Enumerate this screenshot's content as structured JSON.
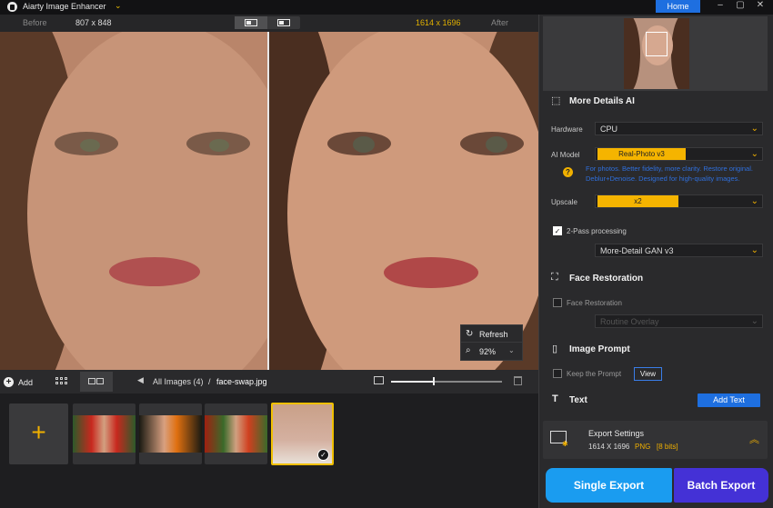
{
  "app": {
    "title": "Aiarty Image Enhancer",
    "home_label": "Home"
  },
  "compare": {
    "before_label": "Before",
    "before_size": "807 x 848",
    "after_size": "1614 x 1696",
    "after_label": "After",
    "view_modes": [
      "split-view-icon",
      "side-by-side-icon"
    ]
  },
  "viewer_tools": {
    "refresh_label": "Refresh",
    "zoom_value": "92%"
  },
  "toolbar": {
    "add_label": "Add",
    "breadcrumb_all": "All Images (4)",
    "breadcrumb_sep": "/",
    "breadcrumb_file": "face-swap.jpg",
    "thumb_size_fraction": 0.39
  },
  "filmstrip": {
    "add_symbol": "+",
    "selected_index": 3,
    "count": 4
  },
  "panel": {
    "more_details": {
      "title": "More Details AI",
      "hardware_label": "Hardware",
      "hardware_value": "CPU",
      "model_label": "AI Model",
      "model_value": "Real-Photo  v3",
      "model_desc": "For photos. Better fidelity, more clarity. Restore original. Deblur+Denoise. Designed for high-quality images.",
      "upscale_label": "Upscale",
      "upscale_value": "x2",
      "two_pass_label": "2-Pass processing",
      "two_pass_checked": true,
      "two_pass_model": "More-Detail GAN  v3"
    },
    "face": {
      "title": "Face Restoration",
      "checkbox_label": "Face Restoration",
      "checked": false,
      "mode_value": "Routine Overlay"
    },
    "prompt": {
      "title": "Image Prompt",
      "keep_label": "Keep the Prompt",
      "keep_checked": false,
      "view_label": "View"
    },
    "text": {
      "title": "Text",
      "add_label": "Add Text"
    },
    "export": {
      "title": "Export Settings",
      "size": "1614 X 1696",
      "format": "PNG",
      "bits": "[8 bits]"
    },
    "single_export_label": "Single Export",
    "batch_export_label": "Batch Export"
  },
  "colors": {
    "accent": "#f5b400",
    "primary": "#1e6fe0",
    "single": "#1a9cf0",
    "batch": "#4431d6"
  }
}
